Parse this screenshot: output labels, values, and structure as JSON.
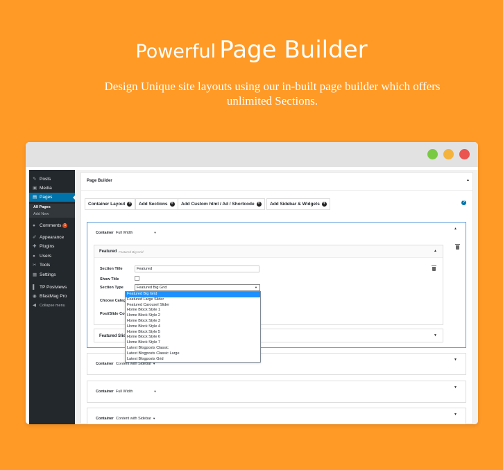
{
  "hero": {
    "title_light": "Powerful",
    "title_bold": "Page Builder",
    "subtitle": "Design Unique site layouts using our in-built page builder which offers unlimited Sections."
  },
  "sidebar": {
    "items": [
      {
        "icon": "pin-icon",
        "glyph": "✎",
        "label": "Posts"
      },
      {
        "icon": "media-icon",
        "glyph": "▣",
        "label": "Media"
      },
      {
        "icon": "pages-icon",
        "glyph": "▤",
        "label": "Pages"
      },
      {
        "icon": "comments-icon",
        "glyph": "●",
        "label": "Comments",
        "badge": "1"
      },
      {
        "icon": "appearance-icon",
        "glyph": "✐",
        "label": "Appearance"
      },
      {
        "icon": "plugins-icon",
        "glyph": "✚",
        "label": "Plugins"
      },
      {
        "icon": "users-icon",
        "glyph": "●",
        "label": "Users"
      },
      {
        "icon": "tools-icon",
        "glyph": "✂",
        "label": "Tools"
      },
      {
        "icon": "settings-icon",
        "glyph": "▦",
        "label": "Settings"
      },
      {
        "icon": "postviews-icon",
        "glyph": "▌",
        "label": "TP Postviews"
      },
      {
        "icon": "bfastmag-icon",
        "glyph": "◉",
        "label": "BfastMag Pro"
      },
      {
        "icon": "collapse-icon",
        "glyph": "◀",
        "label": "Collapse menu"
      }
    ],
    "submenu": [
      "All Pages",
      "Add New"
    ]
  },
  "builder": {
    "title": "Page Builder",
    "toolbar": [
      "Container Layout",
      "Add Sections",
      "Add Custom html / Ad / Shortcode",
      "Add Sidebar & Widgets"
    ],
    "help": "?",
    "container1": {
      "label": "Container",
      "value": "Full Width"
    },
    "featured": {
      "name": "Featured",
      "sub": "Featured Big Grid"
    },
    "fields": {
      "section_title_label": "Section Title",
      "section_title_value": "Featured",
      "show_title_label": "Show Title",
      "section_type_label": "Section Type",
      "section_type_value": "Featured Big Grid",
      "choose_category_label": "Choose Category",
      "post_count_label": "Post/Slide Count"
    },
    "dropdown_options": [
      "Featured Big Grid",
      "Featured Large Slider",
      "Featured Carousel Slider",
      "Home Block Style 1",
      "Home Block Style 2",
      "Home Block Style 3",
      "Home Block Style 4",
      "Home Block Style 5",
      "Home Block Style 6",
      "Home Block Style 7",
      "Latest Blogposts Classic",
      "Latest Blogposts Classic Large",
      "Latest Blogposts Grid"
    ],
    "featured_slider": {
      "name": "Featured Slider",
      "sub": "Fea"
    },
    "container2": {
      "label": "Container",
      "value": "Content with Sidebar"
    },
    "container3": {
      "label": "Container",
      "value": "Full Width"
    },
    "container4": {
      "label": "Container",
      "value": "Content with Sidebar"
    }
  }
}
